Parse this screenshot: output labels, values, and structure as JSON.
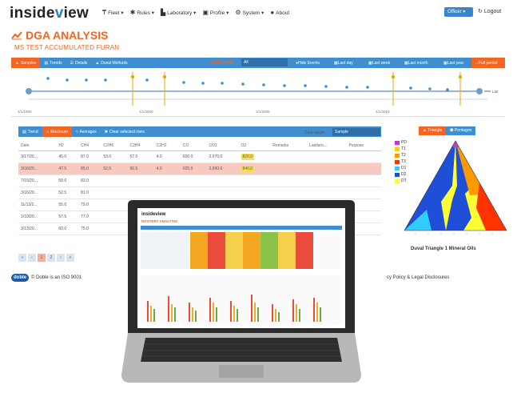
{
  "brand": {
    "prefix": "inside",
    "accent": "v",
    "suffix": "iew"
  },
  "nav": [
    {
      "icon": "fleet-icon",
      "glyph": "₸",
      "label": "Fleet ▾"
    },
    {
      "icon": "rules-icon",
      "glyph": "✱",
      "label": "Rules ▾"
    },
    {
      "icon": "laboratory-icon",
      "glyph": "▙",
      "label": "Laboratory ▾"
    },
    {
      "icon": "profile-icon",
      "glyph": "▣",
      "label": "Profile ▾"
    },
    {
      "icon": "system-icon",
      "glyph": "⚙",
      "label": "System ▾"
    },
    {
      "icon": "about-icon",
      "glyph": "●",
      "label": "About"
    }
  ],
  "user_button": "Officer ▾",
  "logout": "Logout",
  "page_title": "DGA ANALYSIS",
  "page_subtitle": "MS TEST ACCUMULATED FURAN",
  "toolbar": {
    "samples": "Samples",
    "trends": "Trends",
    "details": "Details",
    "duval": "Duval Methods",
    "data_type_label": "DATA TYPE:",
    "data_type_value": "All",
    "hide_events": "Hide Events",
    "last_day": "Last day",
    "last_week": "Last week",
    "last_month": "Last month",
    "last_year": "Last year",
    "full_period": "Full period"
  },
  "timeline_labels": [
    "1/1/1990",
    "1/1/2000",
    "1/1/2005",
    "1/1/2010",
    "Latr"
  ],
  "table_toolbar": {
    "trend": "Trend",
    "maximum": "Maximum",
    "averages": "Averages",
    "clear": "Clear selected rows",
    "range_label": "Data range:",
    "range_value": "Sample"
  },
  "columns": [
    "Date",
    "H2",
    "CH4",
    "C2H6",
    "C2H4",
    "C2H2",
    "CO",
    "CO2",
    "O2",
    "Remarks",
    "Lastlaro...",
    "Purpose"
  ],
  "rows": [
    [
      "3/17/20...",
      "45.0",
      "87.0",
      "53.0",
      "57.0",
      "4.0",
      "600.0",
      "2,970.0",
      "820.0",
      "",
      "",
      ""
    ],
    [
      "3/16/20...",
      "47.5",
      "85.0",
      "52.5",
      "56.5",
      "4.0",
      "625.0",
      "2,990.0",
      "840.0",
      "",
      "",
      ""
    ],
    [
      "7/15/20...",
      "50.0",
      "83.0",
      "",
      "",
      "",
      "",
      "",
      "",
      "",
      "",
      ""
    ],
    [
      "3/16/20...",
      "52.5",
      "81.0",
      "",
      "",
      "",
      "",
      "",
      "",
      "",
      "",
      ""
    ],
    [
      "11/13/2...",
      "55.0",
      "79.0",
      "",
      "",
      "",
      "",
      "",
      "",
      "",
      "",
      ""
    ],
    [
      "1/10/20...",
      "57.5",
      "77.0",
      "",
      "",
      "",
      "",
      "",
      "",
      "",
      "",
      ""
    ],
    [
      "3/13/20...",
      "60.0",
      "75.0",
      "",
      "",
      "",
      "",
      "",
      "",
      "",
      "",
      ""
    ]
  ],
  "pager": [
    "«",
    "‹",
    "1",
    "2",
    "›",
    "»"
  ],
  "footer_left": "© Doble is an ISO 9001",
  "doble_logo": "doble",
  "footer_right": "cy Policy & Legal Disclosures",
  "duval": {
    "tab_triangle": "Triangle",
    "tab_pentagon": "Pentagon",
    "legend": [
      {
        "label": "PD",
        "color": "#cc33cc"
      },
      {
        "label": "T1",
        "color": "#ffcc00"
      },
      {
        "label": "T2",
        "color": "#ff9900"
      },
      {
        "label": "T3",
        "color": "#ff3300"
      },
      {
        "label": "D1",
        "color": "#33ccff"
      },
      {
        "label": "D2",
        "color": "#1f4fd6"
      },
      {
        "label": "DT",
        "color": "#ffff33"
      }
    ],
    "caption": "Duval Triangle 1 Mineral Oils"
  },
  "laptop_screen": {
    "brand": "insideview",
    "title": "MYSTERY ANALYSIS"
  },
  "colors": {
    "accent": "#f26522",
    "bar": "#3f8fd0"
  }
}
